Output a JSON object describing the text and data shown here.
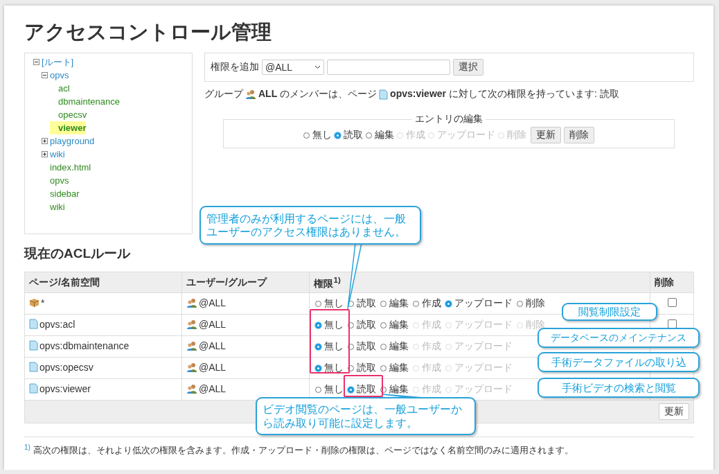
{
  "title": "アクセスコントロール管理",
  "tree": [
    {
      "label": "[ルート]",
      "kind": "namespace",
      "expanded": true,
      "selected": false,
      "children": [
        {
          "label": "opvs",
          "kind": "namespace",
          "expanded": true,
          "selected": false,
          "children": [
            {
              "label": "acl",
              "kind": "page",
              "selected": false
            },
            {
              "label": "dbmaintenance",
              "kind": "page",
              "selected": false
            },
            {
              "label": "opecsv",
              "kind": "page",
              "selected": false
            },
            {
              "label": "viewer",
              "kind": "page",
              "selected": true
            }
          ]
        },
        {
          "label": "playground",
          "kind": "namespace",
          "expanded": false,
          "selected": false
        },
        {
          "label": "wiki",
          "kind": "namespace",
          "expanded": false,
          "selected": false
        },
        {
          "label": "index.html",
          "kind": "page",
          "selected": false
        },
        {
          "label": "opvs",
          "kind": "page",
          "selected": false
        },
        {
          "label": "sidebar",
          "kind": "page",
          "selected": false
        },
        {
          "label": "wiki",
          "kind": "page",
          "selected": false
        }
      ]
    }
  ],
  "add_form": {
    "label": "権限を追加",
    "select_value": "@ALL",
    "button": "選択"
  },
  "info": {
    "prefix": "グループ",
    "middle": "**ALL** のメンバーは、ページ",
    "suffix": "**opvs:viewer** に対して次の権限を持っています: 読取"
  },
  "edit_entry": {
    "legend": "エントリの編集",
    "options": [
      {
        "label": "無し",
        "selected": false,
        "disabled": false
      },
      {
        "label": "読取",
        "selected": true,
        "disabled": false
      },
      {
        "label": "編集",
        "selected": false,
        "disabled": false
      },
      {
        "label": "作成",
        "selected": false,
        "disabled": true
      },
      {
        "label": "アップロード",
        "selected": false,
        "disabled": true
      },
      {
        "label": "削除",
        "selected": false,
        "disabled": true
      }
    ],
    "buttons": [
      "更新",
      "削除"
    ]
  },
  "acl_heading": "現在のACLルール",
  "table": {
    "columns": [
      "ページ/名前空間",
      "ユーザー/グループ",
      "権限$^{1)}$",
      "削除"
    ],
    "rows": [
      {
        "page": "*",
        "kind": "namespace",
        "user": "@ALL",
        "delete": {
          "checked": false
        },
        "permissions": [
          {
            "label": "無し",
            "selected": false,
            "disabled": false
          },
          {
            "label": "読取",
            "selected": false,
            "disabled": false
          },
          {
            "label": "編集",
            "selected": false,
            "disabled": false
          },
          {
            "label": "作成",
            "selected": false,
            "disabled": false
          },
          {
            "label": "アップロード",
            "selected": true,
            "disabled": false
          },
          {
            "label": "削除",
            "selected": false,
            "disabled": false
          }
        ]
      },
      {
        "page": "opvs:acl",
        "kind": "page",
        "user": "@ALL",
        "delete": {
          "checked": false
        },
        "permissions": [
          {
            "label": "無し",
            "selected": true,
            "disabled": false
          },
          {
            "label": "読取",
            "selected": false,
            "disabled": false
          },
          {
            "label": "編集",
            "selected": false,
            "disabled": false
          },
          {
            "label": "作成",
            "selected": false,
            "disabled": true
          },
          {
            "label": "アップロード",
            "selected": false,
            "disabled": true
          },
          {
            "label": "削除",
            "selected": false,
            "disabled": true
          }
        ]
      },
      {
        "page": "opvs:dbmaintenance",
        "kind": "page",
        "user": "@ALL",
        "permissions": [
          {
            "label": "無し",
            "selected": true,
            "disabled": false
          },
          {
            "label": "読取",
            "selected": false,
            "disabled": false
          },
          {
            "label": "編集",
            "selected": false,
            "disabled": false
          },
          {
            "label": "作成",
            "selected": false,
            "disabled": true
          },
          {
            "label": "アップロード",
            "selected": false,
            "disabled": true
          }
        ]
      },
      {
        "page": "opvs:opecsv",
        "kind": "page",
        "user": "@ALL",
        "permissions": [
          {
            "label": "無し",
            "selected": true,
            "disabled": false
          },
          {
            "label": "読取",
            "selected": false,
            "disabled": false
          },
          {
            "label": "編集",
            "selected": false,
            "disabled": false
          },
          {
            "label": "作成",
            "selected": false,
            "disabled": true
          },
          {
            "label": "アップロード",
            "selected": false,
            "disabled": true
          }
        ]
      },
      {
        "page": "opvs:viewer",
        "kind": "page",
        "user": "@ALL",
        "permissions": [
          {
            "label": "無し",
            "selected": false,
            "disabled": false
          },
          {
            "label": "読取",
            "selected": true,
            "disabled": false
          },
          {
            "label": "編集",
            "selected": false,
            "disabled": false
          },
          {
            "label": "作成",
            "selected": false,
            "disabled": true
          },
          {
            "label": "アップロード",
            "selected": false,
            "disabled": true
          }
        ]
      }
    ],
    "update_button": "更新"
  },
  "footnote": "$^{1)}$ 高次の権限は、それより低次の権限を含みます。作成・アップロード・削除の権限は、ページではなく名前空間のみに適用されます。",
  "callouts": [
    {
      "kind": "admin",
      "text": "管理者のみが利用するページには、一般ユーザーのアクセス権限はありません。"
    },
    {
      "kind": "side",
      "text": "閲覧制限設定"
    },
    {
      "kind": "side",
      "text": "データベースのメインテナンス"
    },
    {
      "kind": "side",
      "text": "手術データファイルの取り込"
    },
    {
      "kind": "side",
      "text": "手術ビデオの検索と閲覧"
    },
    {
      "kind": "viewer",
      "text": "ビデオ閲覧のページは、一般ユーザーから読み取り可能に設定します。"
    }
  ]
}
